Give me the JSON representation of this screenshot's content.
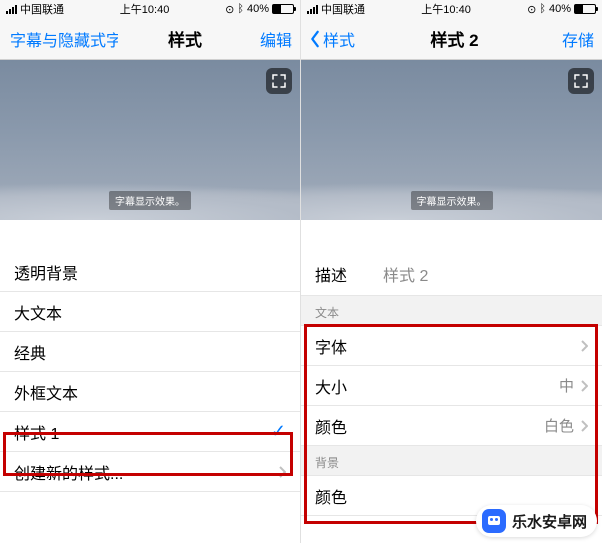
{
  "watermark": "乐水安卓网",
  "left": {
    "status": {
      "carrier": "中国联通",
      "time": "上午10:40",
      "battery": "40%"
    },
    "nav": {
      "back": "字幕与隐藏式字幕",
      "title": "样式",
      "action": "编辑"
    },
    "caption": "字幕显示效果。",
    "rows": {
      "r1": "透明背景",
      "r2": "大文本",
      "r3": "经典",
      "r4": "外框文本",
      "r5": "样式 1",
      "r6": "创建新的样式..."
    }
  },
  "right": {
    "status": {
      "carrier": "中国联通",
      "time": "上午10:40",
      "battery": "40%"
    },
    "nav": {
      "back": "样式",
      "title": "样式 2",
      "action": "存储"
    },
    "caption": "字幕显示效果。",
    "desc": {
      "k": "描述",
      "v": "样式 2"
    },
    "sec_text": "文本",
    "font": {
      "label": "字体"
    },
    "size": {
      "label": "大小",
      "value": "中"
    },
    "color": {
      "label": "颜色",
      "value": "白色"
    },
    "sec_bg": "背景",
    "bgcolor": {
      "label": "颜色"
    }
  }
}
